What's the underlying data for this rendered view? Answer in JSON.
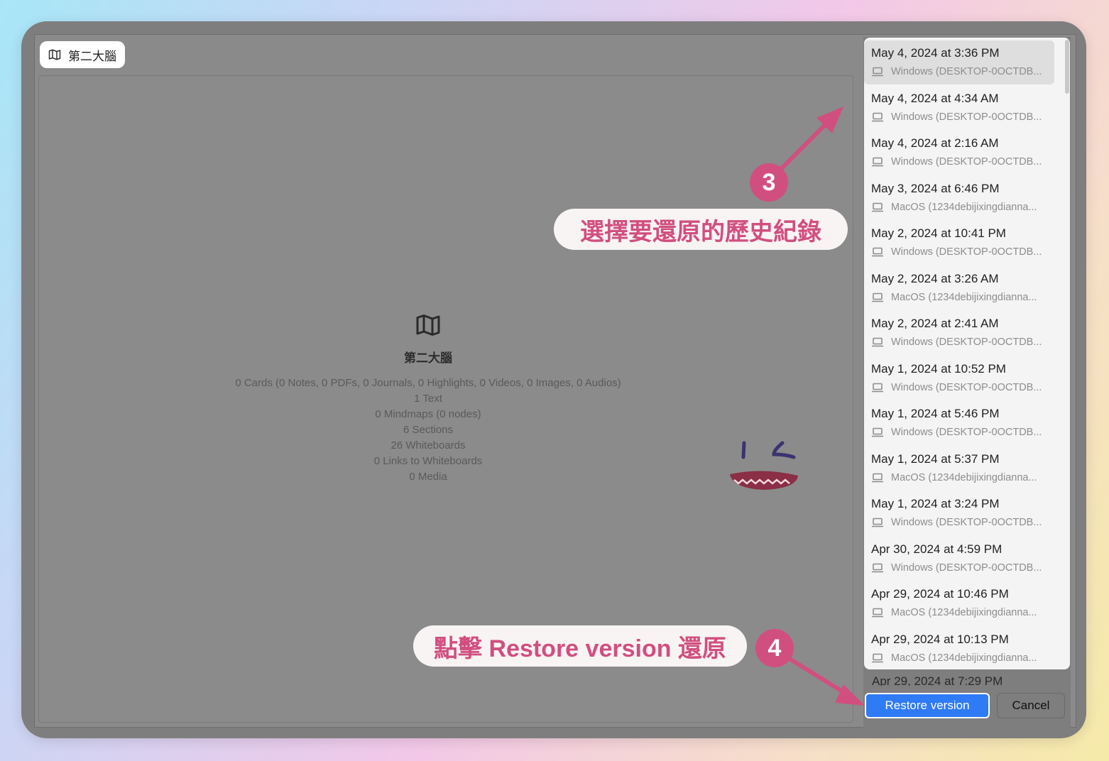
{
  "preview": {
    "title": "第二大腦",
    "name": "第二大腦",
    "stats": [
      "0 Cards (0 Notes, 0 PDFs, 0 Journals, 0 Highlights, 0 Videos, 0 Images, 0 Audios)",
      "1 Text",
      "0 Mindmaps (0 nodes)",
      "6 Sections",
      "26 Whiteboards",
      "0 Links to Whiteboards",
      "0 Media"
    ]
  },
  "versions": [
    {
      "date": "May 4, 2024 at 3:36 PM",
      "device": "Windows (DESKTOP-0OCTDB...",
      "selected": true
    },
    {
      "date": "May 4, 2024 at 4:34 AM",
      "device": "Windows (DESKTOP-0OCTDB..."
    },
    {
      "date": "May 4, 2024 at 2:16 AM",
      "device": "Windows (DESKTOP-0OCTDB..."
    },
    {
      "date": "May 3, 2024 at 6:46 PM",
      "device": "MacOS (1234debijixingdianna..."
    },
    {
      "date": "May 2, 2024 at 10:41 PM",
      "device": "Windows (DESKTOP-0OCTDB..."
    },
    {
      "date": "May 2, 2024 at 3:26 AM",
      "device": "MacOS (1234debijixingdianna..."
    },
    {
      "date": "May 2, 2024 at 2:41 AM",
      "device": "Windows (DESKTOP-0OCTDB..."
    },
    {
      "date": "May 1, 2024 at 10:52 PM",
      "device": "Windows (DESKTOP-0OCTDB..."
    },
    {
      "date": "May 1, 2024 at 5:46 PM",
      "device": "Windows (DESKTOP-0OCTDB..."
    },
    {
      "date": "May 1, 2024 at 5:37 PM",
      "device": "MacOS (1234debijixingdianna..."
    },
    {
      "date": "May 1, 2024 at 3:24 PM",
      "device": "Windows (DESKTOP-0OCTDB..."
    },
    {
      "date": "Apr 30, 2024 at 4:59 PM",
      "device": "Windows (DESKTOP-0OCTDB..."
    },
    {
      "date": "Apr 29, 2024 at 10:46 PM",
      "device": "MacOS (1234debijixingdianna..."
    },
    {
      "date": "Apr 29, 2024 at 10:13 PM",
      "device": "MacOS (1234debijixingdianna..."
    }
  ],
  "cut_off_item": "Apr 29, 2024 at 7:29 PM",
  "buttons": {
    "restore": "Restore version",
    "cancel": "Cancel"
  },
  "annotations": {
    "step3_badge": "3",
    "step3_text": "選擇要還原的歷史紀錄",
    "step4_badge": "4",
    "step4_text": "點擊 Restore version 還原",
    "accent_color": "#d14f7f"
  }
}
